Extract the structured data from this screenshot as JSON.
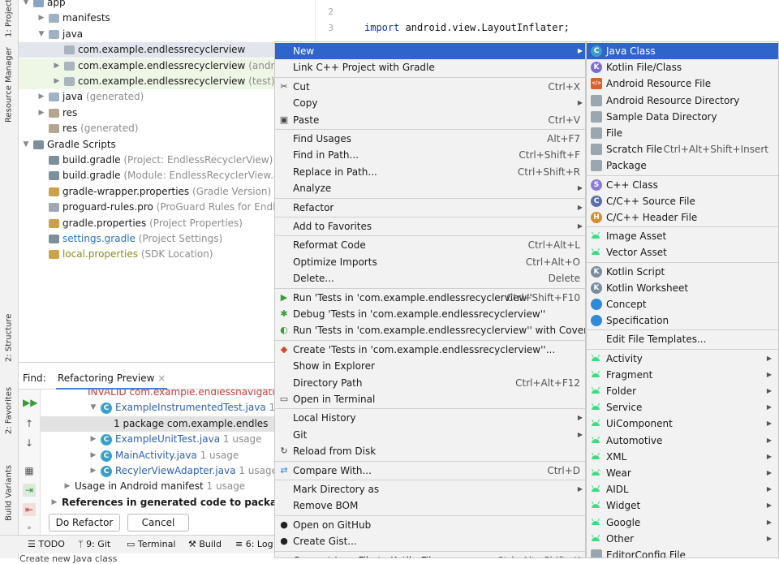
{
  "sidebar_left": {
    "tabs": [
      "1: Project",
      "Resource Manager",
      "2: Structure",
      "2: Favorites",
      "Build Variants"
    ]
  },
  "tree": {
    "rows": [
      {
        "label": "app",
        "hint": "",
        "icon": "module-folder-icon",
        "indent": 0,
        "arrow": "open"
      },
      {
        "label": "manifests",
        "hint": "",
        "icon": "folder-icon",
        "indent": 1,
        "arrow": "closed"
      },
      {
        "label": "java",
        "hint": "",
        "icon": "folder-icon",
        "indent": 1,
        "arrow": "open"
      },
      {
        "label": "com.example.endlessrecyclerview",
        "hint": "",
        "icon": "package-icon",
        "indent": 2,
        "arrow": "none",
        "state": "sel"
      },
      {
        "label": "com.example.endlessrecyclerview",
        "hint": "(androidTest)",
        "icon": "package-icon",
        "indent": 2,
        "arrow": "closed",
        "state": "test"
      },
      {
        "label": "com.example.endlessrecyclerview",
        "hint": "(test)",
        "icon": "package-icon",
        "indent": 2,
        "arrow": "closed",
        "state": "test"
      },
      {
        "label": "java",
        "hint": "(generated)",
        "icon": "generated-folder-icon",
        "indent": 1,
        "arrow": "closed"
      },
      {
        "label": "res",
        "hint": "",
        "icon": "res-folder-icon",
        "indent": 1,
        "arrow": "closed"
      },
      {
        "label": "res",
        "hint": "(generated)",
        "icon": "res-folder-icon",
        "indent": 1,
        "arrow": "none"
      },
      {
        "label": "Gradle Scripts",
        "hint": "",
        "icon": "gradle-icon",
        "indent": 0,
        "arrow": "open"
      },
      {
        "label": "build.gradle",
        "hint": "(Project: EndlessRecyclerView)",
        "icon": "gradle-icon",
        "indent": 1,
        "arrow": "none"
      },
      {
        "label": "build.gradle",
        "hint": "(Module: EndlessRecyclerView.app)",
        "icon": "gradle-icon",
        "indent": 1,
        "arrow": "none"
      },
      {
        "label": "gradle-wrapper.properties",
        "hint": "(Gradle Version)",
        "icon": "properties-icon",
        "indent": 1,
        "arrow": "none"
      },
      {
        "label": "proguard-rules.pro",
        "hint": "(ProGuard Rules for EndlessRec",
        "icon": "file-icon",
        "indent": 1,
        "arrow": "none"
      },
      {
        "label": "gradle.properties",
        "hint": "(Project Properties)",
        "icon": "properties-icon",
        "indent": 1,
        "arrow": "none"
      },
      {
        "label": "settings.gradle",
        "hint": "(Project Settings)",
        "icon": "gradle-icon",
        "indent": 1,
        "arrow": "none",
        "color": "blue"
      },
      {
        "label": "local.properties",
        "hint": "(SDK Location)",
        "icon": "properties-icon",
        "indent": 1,
        "arrow": "none",
        "color": "olive"
      }
    ]
  },
  "editor": {
    "lines": [
      {
        "num": "2",
        "keyword": "",
        "text": ""
      },
      {
        "num": "3",
        "keyword": "import",
        "text": " android.view.LayoutInflater;"
      }
    ]
  },
  "find_panel": {
    "label": "Find:",
    "tab": "Refactoring Preview",
    "close": "×",
    "rows": [
      {
        "text": "INVALID com.example.endlessnavigati",
        "hint": "",
        "indent": 3,
        "color": "red"
      },
      {
        "text": "ExampleInstrumentedTest.java",
        "hint": "1 us",
        "indent": 4,
        "color": "blue"
      },
      {
        "text": "1 package com.example.endles",
        "hint": "",
        "indent": 5,
        "state": "sel"
      },
      {
        "text": "ExampleUnitTest.java",
        "hint": "1 usage",
        "indent": 4,
        "color": "blue"
      },
      {
        "text": "MainActivity.java",
        "hint": "1 usage",
        "indent": 4,
        "color": "blue"
      },
      {
        "text": "RecylerViewAdapter.java",
        "hint": "1 usage",
        "indent": 4,
        "color": "blue"
      },
      {
        "text": "Usage in Android manifest",
        "hint": "1 usage",
        "indent": 2
      },
      {
        "text": "References in generated code to package com.exa",
        "hint": "",
        "indent": 1,
        "bold": true
      }
    ],
    "do_refactor": "Do Refactor",
    "cancel": "Cancel"
  },
  "bottom_bar": {
    "tabs": [
      "TODO",
      "9: Git",
      "Terminal",
      "Build",
      "6: Log"
    ],
    "status": "Create new Java class"
  },
  "context_menu": {
    "items": [
      {
        "label": "New",
        "shortcut": "",
        "submenu": true,
        "highlight": true
      },
      {
        "label": "Link C++ Project with Gradle",
        "shortcut": ""
      },
      {
        "sep": true
      },
      {
        "label": "Cut",
        "shortcut": "Ctrl+X",
        "icon": "scissors-icon"
      },
      {
        "label": "Copy",
        "shortcut": "",
        "submenu": true
      },
      {
        "label": "Paste",
        "shortcut": "Ctrl+V",
        "icon": "clipboard-icon"
      },
      {
        "sep": true
      },
      {
        "label": "Find Usages",
        "shortcut": "Alt+F7"
      },
      {
        "label": "Find in Path...",
        "shortcut": "Ctrl+Shift+F"
      },
      {
        "label": "Replace in Path...",
        "shortcut": "Ctrl+Shift+R"
      },
      {
        "label": "Analyze",
        "shortcut": "",
        "submenu": true
      },
      {
        "sep": true
      },
      {
        "label": "Refactor",
        "shortcut": "",
        "submenu": true
      },
      {
        "sep": true
      },
      {
        "label": "Add to Favorites",
        "shortcut": "",
        "submenu": true
      },
      {
        "sep": true
      },
      {
        "label": "Reformat Code",
        "shortcut": "Ctrl+Alt+L"
      },
      {
        "label": "Optimize Imports",
        "shortcut": "Ctrl+Alt+O"
      },
      {
        "label": "Delete...",
        "shortcut": "Delete"
      },
      {
        "sep": true
      },
      {
        "label": "Run 'Tests in 'com.example.endlessrecyclerview''",
        "shortcut": "Ctrl+Shift+F10",
        "icon": "run-icon"
      },
      {
        "label": "Debug 'Tests in 'com.example.endlessrecyclerview''",
        "shortcut": "",
        "icon": "debug-icon"
      },
      {
        "label": "Run 'Tests in 'com.example.endlessrecyclerview'' with Coverage",
        "shortcut": "",
        "icon": "coverage-icon"
      },
      {
        "sep": true
      },
      {
        "label": "Create 'Tests in 'com.example.endlessrecyclerview''...",
        "shortcut": "",
        "icon": "create-test-icon"
      },
      {
        "label": "Show in Explorer",
        "shortcut": ""
      },
      {
        "label": "Directory Path",
        "shortcut": "Ctrl+Alt+F12"
      },
      {
        "label": "Open in Terminal",
        "shortcut": "",
        "icon": "terminal-icon"
      },
      {
        "sep": true
      },
      {
        "label": "Local History",
        "shortcut": "",
        "submenu": true
      },
      {
        "label": "Git",
        "shortcut": "",
        "submenu": true
      },
      {
        "label": "Reload from Disk",
        "shortcut": "",
        "icon": "reload-icon"
      },
      {
        "sep": true
      },
      {
        "label": "Compare With...",
        "shortcut": "Ctrl+D",
        "icon": "compare-icon"
      },
      {
        "sep": true
      },
      {
        "label": "Mark Directory as",
        "shortcut": "",
        "submenu": true
      },
      {
        "label": "Remove BOM",
        "shortcut": ""
      },
      {
        "sep": true
      },
      {
        "label": "Open on GitHub",
        "shortcut": "",
        "icon": "github-icon"
      },
      {
        "label": "Create Gist...",
        "shortcut": "",
        "icon": "github-icon"
      },
      {
        "sep": true
      },
      {
        "label": "Convert Java File to Kotlin File",
        "shortcut": "Ctrl+Alt+Shift+K"
      }
    ]
  },
  "new_submenu": {
    "items": [
      {
        "label": "Java Class",
        "icon": "java-class-icon",
        "icon_letter": "C",
        "icon_color": "#3aa0c8",
        "highlight": true
      },
      {
        "label": "Kotlin File/Class",
        "icon": "kotlin-file-icon",
        "icon_letter": "K",
        "icon_color": "#7f6bd6"
      },
      {
        "label": "Android Resource File",
        "icon": "android-resource-file-icon",
        "icon_letter": "</>",
        "icon_color": "#d9622b"
      },
      {
        "label": "Android Resource Directory",
        "icon": "folder-icon",
        "icon_letter": "",
        "icon_color": "#9aa7b0"
      },
      {
        "label": "Sample Data Directory",
        "icon": "folder-icon",
        "icon_letter": "",
        "icon_color": "#9aa7b0"
      },
      {
        "label": "File",
        "icon": "file-icon",
        "icon_letter": "",
        "icon_color": "#9aa7b0"
      },
      {
        "label": "Scratch File",
        "icon": "scratch-file-icon",
        "icon_letter": "",
        "icon_color": "#9aa7b0",
        "shortcut": "Ctrl+Alt+Shift+Insert"
      },
      {
        "label": "Package",
        "icon": "package-icon",
        "icon_letter": "",
        "icon_color": "#9aa7b0"
      },
      {
        "sep": true
      },
      {
        "label": "C++ Class",
        "icon": "cpp-class-icon",
        "icon_letter": "S",
        "icon_color": "#8c7ad6"
      },
      {
        "label": "C/C++ Source File",
        "icon": "cpp-source-icon",
        "icon_letter": "C",
        "icon_color": "#5a6fae"
      },
      {
        "label": "C/C++ Header File",
        "icon": "cpp-header-icon",
        "icon_letter": "H",
        "icon_color": "#d98c2b"
      },
      {
        "sep": true
      },
      {
        "label": "Image Asset",
        "icon": "android-icon",
        "icon_letter": "",
        "icon_color": "#3ddc84"
      },
      {
        "label": "Vector Asset",
        "icon": "android-icon",
        "icon_letter": "",
        "icon_color": "#3ddc84"
      },
      {
        "sep": true
      },
      {
        "label": "Kotlin Script",
        "icon": "kotlin-script-icon",
        "icon_letter": "K",
        "icon_color": "#7a8c9e"
      },
      {
        "label": "Kotlin Worksheet",
        "icon": "kotlin-worksheet-icon",
        "icon_letter": "K",
        "icon_color": "#7a8c9e"
      },
      {
        "label": "Concept",
        "icon": "concept-icon",
        "icon_letter": "",
        "icon_color": "#2f8bd8"
      },
      {
        "label": "Specification",
        "icon": "specification-icon",
        "icon_letter": "",
        "icon_color": "#2f8bd8"
      },
      {
        "sep": true
      },
      {
        "label": "Edit File Templates...",
        "icon": "",
        "icon_letter": "",
        "icon_color": ""
      },
      {
        "sep": true
      },
      {
        "label": "Activity",
        "icon": "android-icon",
        "submenu": true
      },
      {
        "label": "Fragment",
        "icon": "android-icon",
        "submenu": true
      },
      {
        "label": "Folder",
        "icon": "android-icon",
        "submenu": true
      },
      {
        "label": "Service",
        "icon": "android-icon",
        "submenu": true
      },
      {
        "label": "UiComponent",
        "icon": "android-icon",
        "submenu": true
      },
      {
        "label": "Automotive",
        "icon": "android-icon",
        "submenu": true
      },
      {
        "label": "XML",
        "icon": "android-icon",
        "submenu": true
      },
      {
        "label": "Wear",
        "icon": "android-icon",
        "submenu": true
      },
      {
        "label": "AIDL",
        "icon": "android-icon",
        "submenu": true
      },
      {
        "label": "Widget",
        "icon": "android-icon",
        "submenu": true
      },
      {
        "label": "Google",
        "icon": "android-icon",
        "submenu": true
      },
      {
        "label": "Other",
        "icon": "android-icon",
        "submenu": true
      },
      {
        "label": "EditorConfig File",
        "icon": "editorconfig-icon",
        "icon_letter": "",
        "icon_color": "#9aa7b0"
      }
    ]
  },
  "colors": {
    "highlight": "#2f65ca",
    "android_green": "#3ddc84",
    "test_green_bg": "#eef6e6",
    "selected_bg": "#e2e6ec",
    "hint_gray": "#8c8c8c"
  }
}
